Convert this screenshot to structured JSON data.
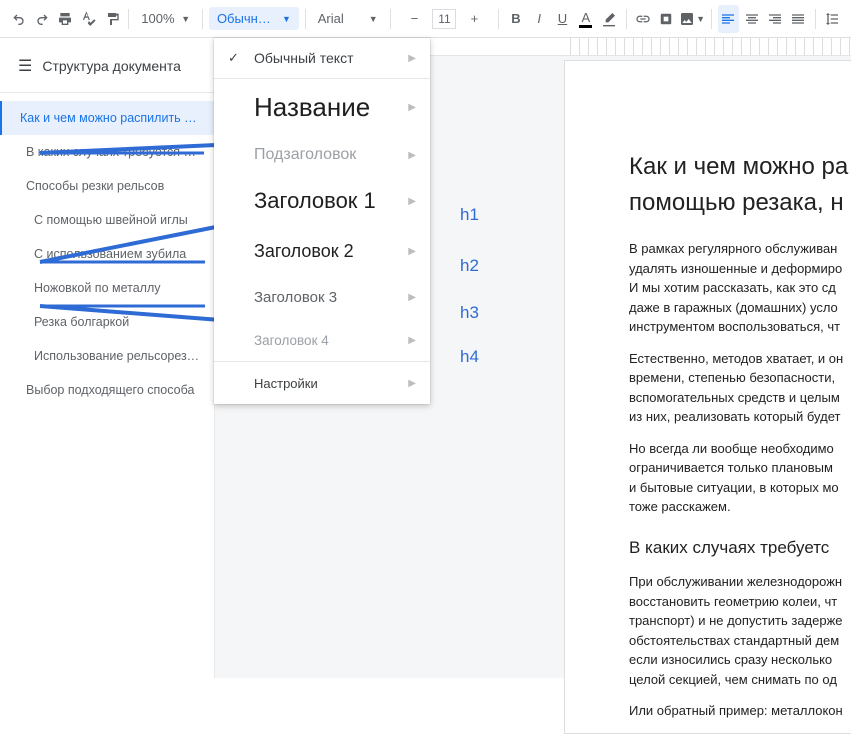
{
  "toolbar": {
    "zoom": "100%",
    "style": "Обычный …",
    "font": "Arial",
    "font_size": "11"
  },
  "sidebar": {
    "title": "Структура документа",
    "items": [
      {
        "label": "Как и чем можно распилить ре…",
        "level": 1,
        "selected": true
      },
      {
        "label": "В каких случаях требуется ре…",
        "level": 2,
        "selected": false
      },
      {
        "label": "Способы резки рельсов",
        "level": 2,
        "selected": false
      },
      {
        "label": "С помощью швейной иглы",
        "level": 3,
        "selected": false
      },
      {
        "label": "С использованием зубила",
        "level": 3,
        "selected": false
      },
      {
        "label": "Ножовкой по металлу",
        "level": 3,
        "selected": false
      },
      {
        "label": "Резка болгаркой",
        "level": 3,
        "selected": false
      },
      {
        "label": "Использование рельсорезо…",
        "level": 3,
        "selected": false
      },
      {
        "label": "Выбор подходящего способа",
        "level": 2,
        "selected": false
      }
    ]
  },
  "dropdown": {
    "items": [
      {
        "key": "normal",
        "label": "Обычный текст",
        "checked": true
      },
      {
        "key": "title",
        "label": "Название"
      },
      {
        "key": "subtitle",
        "label": "Подзаголовок"
      },
      {
        "key": "h1",
        "label": "Заголовок 1"
      },
      {
        "key": "h2",
        "label": "Заголовок 2"
      },
      {
        "key": "h3",
        "label": "Заголовок 3"
      },
      {
        "key": "h4",
        "label": "Заголовок 4"
      },
      {
        "key": "opt",
        "label": "Настройки"
      }
    ]
  },
  "annotations": {
    "h1": "h1",
    "h2": "h2",
    "h3": "h3",
    "h4": "h4"
  },
  "doc": {
    "h1": "Как и чем можно ра",
    "h1b": "помощью резака, н",
    "p1": "В рамках регулярного обслуживан",
    "p2": "удалять изношенные и деформиро",
    "p3": "И мы хотим рассказать, как это сд",
    "p4": "даже в гаражных (домашних) усло",
    "p5": "инструментом воспользоваться, чт",
    "p6": "Естественно, методов хватает, и он",
    "p7": "времени, степенью безопасности,",
    "p8": "вспомогательных средств и целым",
    "p9": "из них, реализовать который будет",
    "p10": "Но всегда ли вообще необходимо",
    "p11": "ограничивается только плановым",
    "p12": "и бытовые ситуации, в которых мо",
    "p13": "тоже расскажем.",
    "h2": "В каких случаях требуетс",
    "p14": "При обслуживании железнодорожн",
    "p15": "восстановить геометрию колеи, чт",
    "p16": "транспорт) и не допустить задерже",
    "p17": "обстоятельствах стандартный дем",
    "p18": "если износились сразу несколько",
    "p19": "целой секцией, чем снимать по од",
    "p20": "Или обратный пример: металлокон"
  }
}
